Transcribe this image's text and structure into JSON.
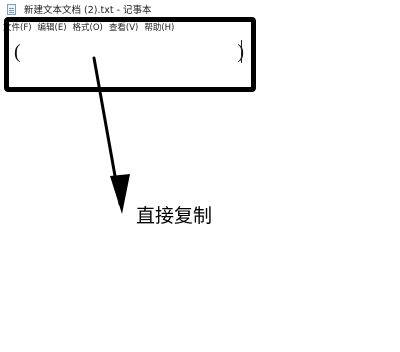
{
  "window": {
    "title": "新建文本文档 (2).txt - 记事本",
    "icon": "notepad-icon"
  },
  "menubar": {
    "items": [
      {
        "label": "文件(F)"
      },
      {
        "label": "编辑(E)"
      },
      {
        "label": "格式(O)"
      },
      {
        "label": "查看(V)"
      },
      {
        "label": "帮助(H)"
      }
    ]
  },
  "editor": {
    "left_paren": "(",
    "right_paren": ")"
  },
  "annotation": {
    "label": "直接复制",
    "color": "#000000"
  }
}
